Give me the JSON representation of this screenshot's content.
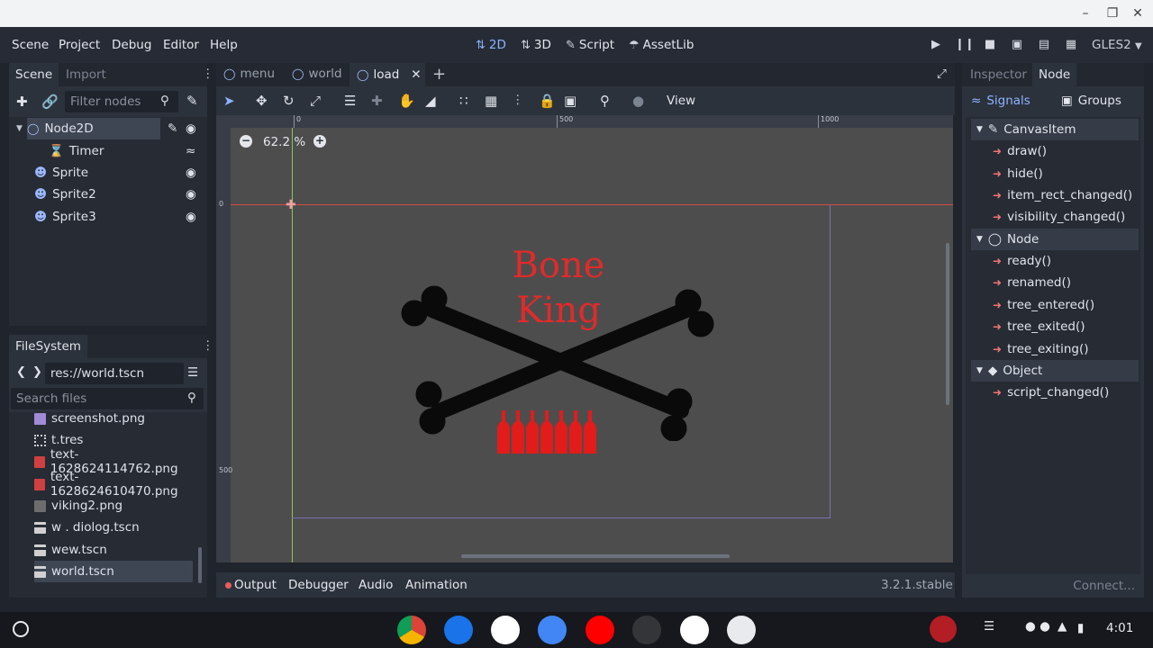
{
  "menubar": {
    "menus": [
      "Scene",
      "Project",
      "Debug",
      "Editor",
      "Help"
    ],
    "workspaces": [
      {
        "label": "2D",
        "icon": "2d-icon",
        "active": true
      },
      {
        "label": "3D",
        "icon": "3d-icon",
        "active": false
      },
      {
        "label": "Script",
        "icon": "script-icon",
        "active": false
      },
      {
        "label": "AssetLib",
        "icon": "assetlib-icon",
        "active": false
      }
    ],
    "renderer": "GLES2"
  },
  "scene_dock": {
    "tabs": [
      "Scene",
      "Import"
    ],
    "filter_placeholder": "Filter nodes",
    "nodes": [
      {
        "label": "Node2D",
        "icon": "node2d-icon",
        "selected": true
      },
      {
        "label": "Timer",
        "icon": "timer-icon"
      },
      {
        "label": "Sprite",
        "icon": "sprite-icon"
      },
      {
        "label": "Sprite2",
        "icon": "sprite-icon"
      },
      {
        "label": "Sprite3",
        "icon": "sprite-icon"
      }
    ]
  },
  "filesystem": {
    "title": "FileSystem",
    "path": "res://world.tscn",
    "search_placeholder": "Search files",
    "files": [
      {
        "label": "screenshot.png",
        "color": "#a28ad6"
      },
      {
        "label": "t.tres",
        "color": "#d0d0d0"
      },
      {
        "label": "text-1628624114762.png",
        "color": "#d04040"
      },
      {
        "label": "text-1628624610470.png",
        "color": "#d04040"
      },
      {
        "label": "viking2.png",
        "color": "#9a9a9a"
      },
      {
        "label": "w . diolog.tscn",
        "color": "#d0d0d0"
      },
      {
        "label": "wew.tscn",
        "color": "#d0d0d0"
      },
      {
        "label": "world.tscn",
        "color": "#d0d0d0",
        "selected": true
      }
    ]
  },
  "editor": {
    "tabs": [
      {
        "label": "menu",
        "active": false
      },
      {
        "label": "world",
        "active": false
      },
      {
        "label": "load",
        "active": true
      }
    ],
    "toolbar": {
      "view_label": "View"
    },
    "zoom": "62.2 %",
    "ruler": {
      "h_ticks": [
        "0",
        "500",
        "1000"
      ],
      "v_ticks": [
        "0",
        "500"
      ]
    },
    "canvas": {
      "title": "Bone King",
      "title_color": "#e12a2a",
      "bottle_count": 7
    }
  },
  "bottom_panel": {
    "tabs": [
      "Output",
      "Debugger",
      "Audio",
      "Animation"
    ],
    "version": "3.2.1.stable"
  },
  "inspector": {
    "tabs": [
      "Inspector",
      "Node"
    ],
    "subtabs": [
      "Signals",
      "Groups"
    ],
    "groups": [
      {
        "label": "CanvasItem",
        "signals": [
          "draw()",
          "hide()",
          "item_rect_changed()",
          "visibility_changed()"
        ]
      },
      {
        "label": "Node",
        "signals": [
          "ready()",
          "renamed()",
          "tree_entered()",
          "tree_exited()",
          "tree_exiting()"
        ]
      },
      {
        "label": "Object",
        "signals": [
          "script_changed()"
        ]
      }
    ],
    "connect_label": "Connect..."
  },
  "shelf": {
    "time": "4:01",
    "apps": [
      "chrome-icon",
      "messages-icon",
      "gmail-icon",
      "docs-icon",
      "youtube-icon",
      "terminal-icon",
      "play-store-icon",
      "linux-icon"
    ]
  }
}
